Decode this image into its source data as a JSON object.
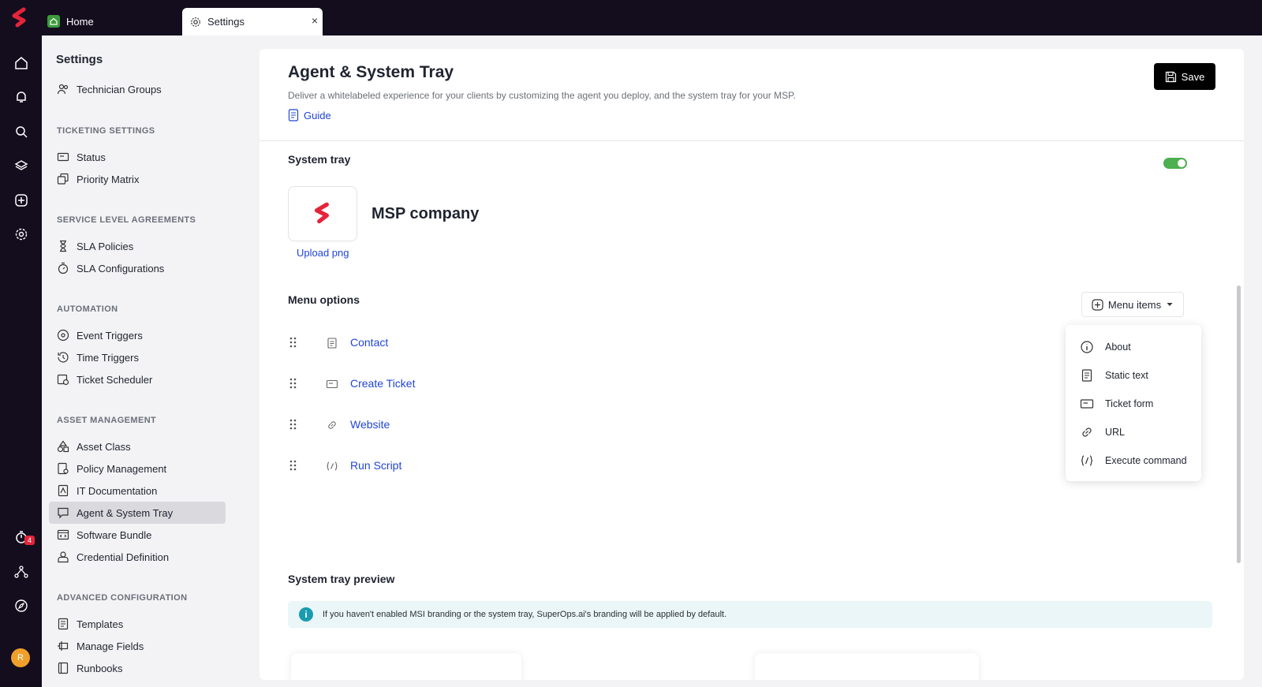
{
  "topbar": {
    "tabs": [
      {
        "label": "Home",
        "icon": "home-icon"
      },
      {
        "label": "Settings",
        "icon": "gear-icon",
        "close": "×"
      }
    ]
  },
  "rail": {
    "badge_count": "4",
    "avatar_initial": "R"
  },
  "sidebar": {
    "title": "Settings",
    "items_top": [
      {
        "label": "Technician Groups",
        "icon": "users-icon"
      }
    ],
    "sections": [
      {
        "title": "TICKETING SETTINGS",
        "items": [
          "Status",
          "Priority Matrix"
        ]
      },
      {
        "title": "SERVICE LEVEL AGREEMENTS",
        "items": [
          "SLA Policies",
          "SLA Configurations"
        ]
      },
      {
        "title": "AUTOMATION",
        "items": [
          "Event Triggers",
          "Time Triggers",
          "Ticket Scheduler"
        ]
      },
      {
        "title": "ASSET MANAGEMENT",
        "items": [
          "Asset Class",
          "Policy Management",
          "IT Documentation",
          "Agent & System Tray",
          "Software Bundle",
          "Credential Definition"
        ]
      },
      {
        "title": "ADVANCED CONFIGURATION",
        "items": [
          "Templates",
          "Manage Fields",
          "Runbooks"
        ]
      }
    ],
    "active_item": "Agent & System Tray"
  },
  "main": {
    "title": "Agent & System Tray",
    "subtitle": "Deliver a whitelabeled experience for your clients by customizing the agent you deploy, and the system tray for your MSP.",
    "guide_label": "Guide",
    "save_label": "Save",
    "system_tray": {
      "title": "System tray",
      "enabled": true,
      "company_name": "MSP company",
      "upload_label": "Upload png"
    },
    "menu_options": {
      "title": "Menu options",
      "menu_items_button": "Menu items",
      "rows": [
        {
          "label": "Contact",
          "icon": "document-icon"
        },
        {
          "label": "Create Ticket",
          "icon": "ticket-icon"
        },
        {
          "label": "Website",
          "icon": "link-icon"
        },
        {
          "label": "Run Script",
          "icon": "code-icon"
        }
      ],
      "dropdown": [
        {
          "label": "About",
          "icon": "info-icon"
        },
        {
          "label": "Static text",
          "icon": "document-icon"
        },
        {
          "label": "Ticket form",
          "icon": "ticket-icon"
        },
        {
          "label": "URL",
          "icon": "link-icon"
        },
        {
          "label": "Execute command",
          "icon": "code-icon"
        }
      ]
    },
    "preview": {
      "title": "System tray preview",
      "info_text": "If you haven't enabled MSI branding or the system tray, SuperOps.ai's branding will be applied by default."
    }
  },
  "colors": {
    "brand": "#e5243b",
    "link": "#2145d6",
    "toggle_on": "#4caf50",
    "dark_bg": "#130d1e"
  }
}
